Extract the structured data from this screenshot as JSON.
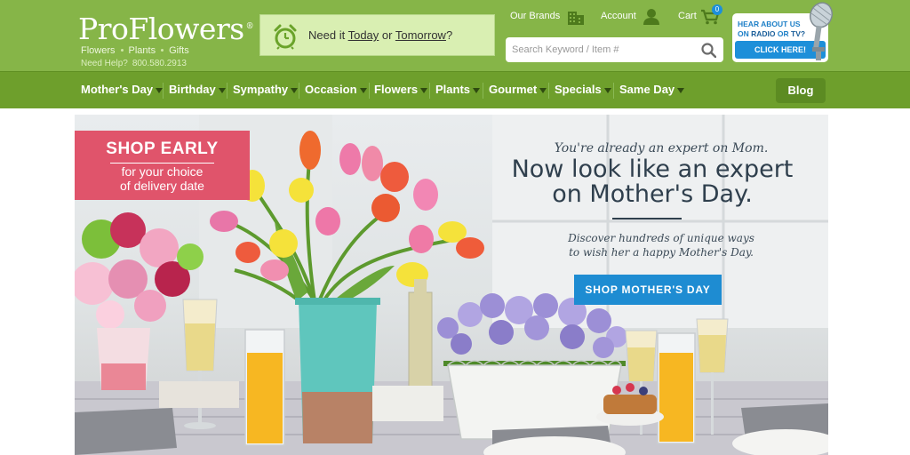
{
  "brand": {
    "name": "ProFlowers",
    "reg": "®",
    "tagline": [
      "Flowers",
      "Plants",
      "Gifts"
    ],
    "help_label": "Need Help?",
    "help_phone": "800.580.2913"
  },
  "delivery": {
    "prefix": "Need it",
    "today": "Today",
    "or": "or",
    "tomorrow": "Tomorrow",
    "suffix": "?"
  },
  "utility": {
    "brands": "Our Brands",
    "account": "Account",
    "cart": "Cart",
    "cart_count": "0"
  },
  "search": {
    "placeholder": "Search Keyword / Item #"
  },
  "radio_promo": {
    "line1_a": "HEAR ABOUT US",
    "line2_a": "ON",
    "line2_b": "RADIO",
    "line2_c": "OR",
    "line2_d": "TV?",
    "button": "CLICK HERE!"
  },
  "nav": {
    "items": [
      "Mother's Day",
      "Birthday",
      "Sympathy",
      "Occasion",
      "Flowers",
      "Plants",
      "Gourmet",
      "Specials",
      "Same Day"
    ],
    "blog": "Blog"
  },
  "hero": {
    "promo_title": "SHOP EARLY",
    "promo_line1": "for your choice",
    "promo_line2": "of delivery date",
    "kicker": "You're already an expert on Mom.",
    "headline_1": "Now look like an expert",
    "headline_2": "on Mother's Day.",
    "sub_1": "Discover hundreds of unique ways",
    "sub_2": "to wish her a happy Mother's Day.",
    "cta": "SHOP MOTHER'S DAY"
  },
  "colors": {
    "header_green": "#86b548",
    "nav_green": "#6e9f2c",
    "promo_pink": "#e0546b",
    "cta_blue": "#1e8cd2"
  }
}
